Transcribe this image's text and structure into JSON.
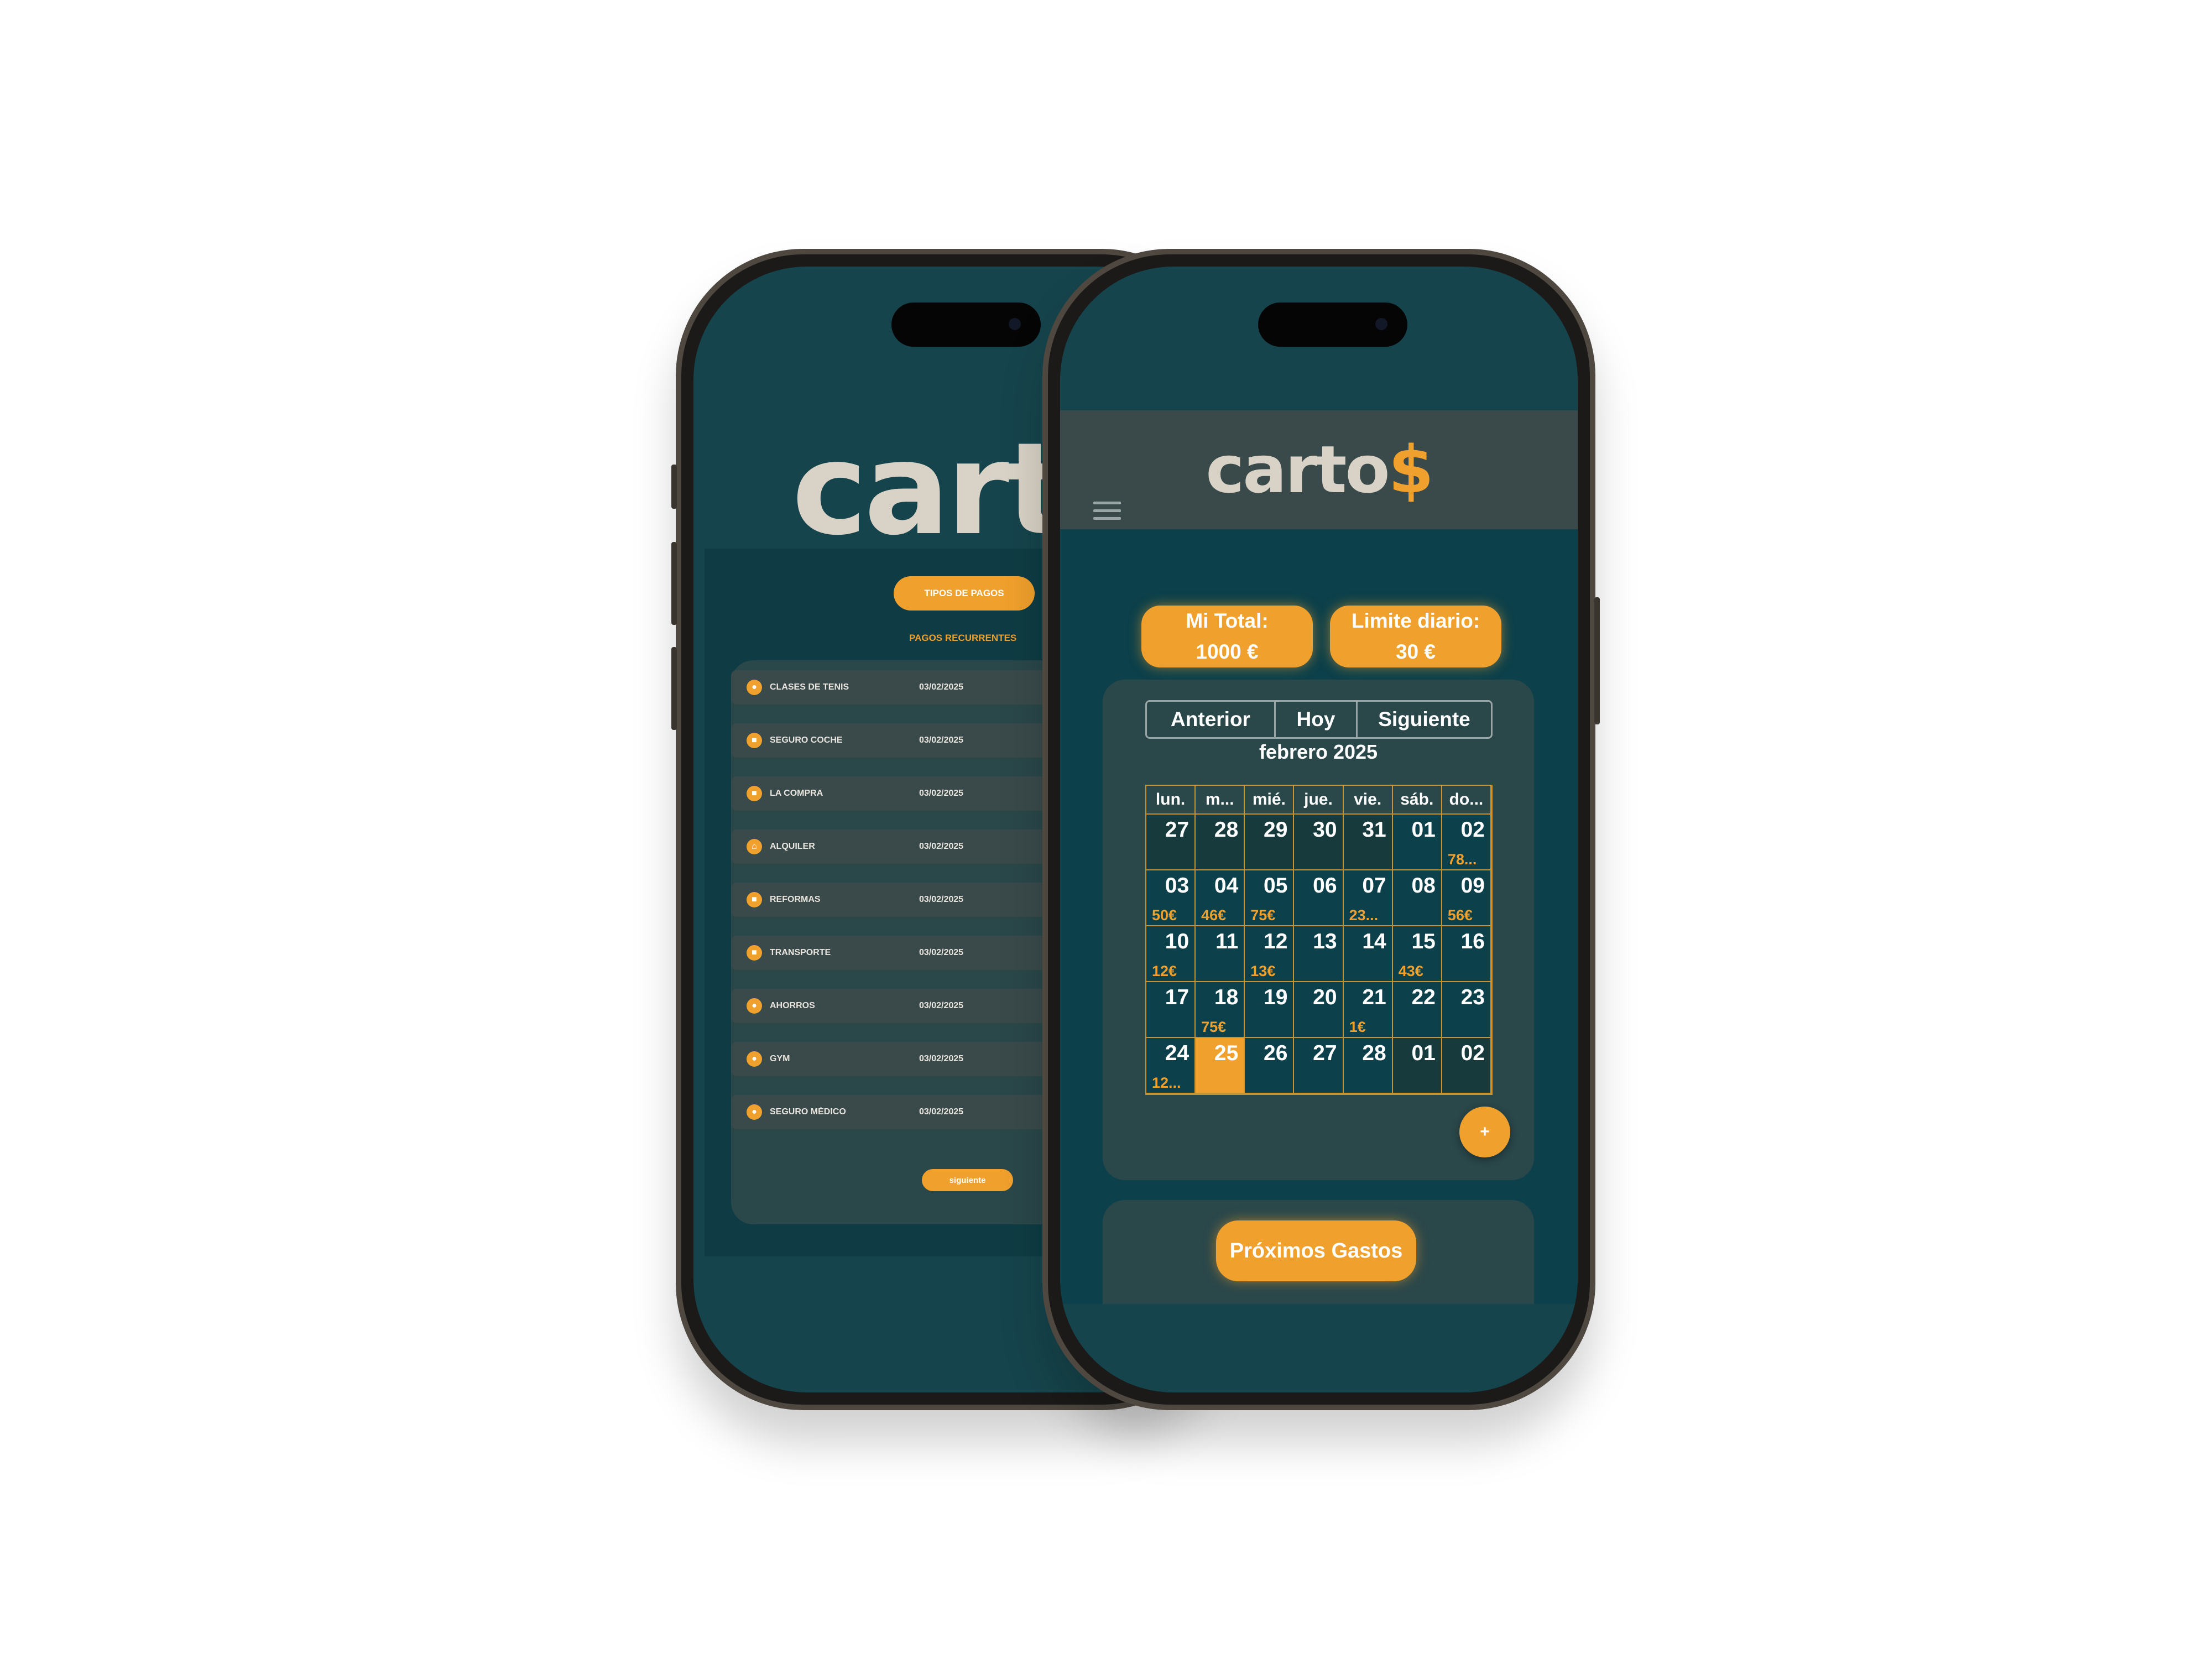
{
  "back_screen": {
    "logo_text": "carto",
    "types_button": "TIPOS DE PAGOS",
    "recurring_title": "PAGOS RECURRENTES",
    "items": [
      {
        "icon": "tennis-ball-icon",
        "glyph": "●",
        "name": "CLASES DE TENIS",
        "date": "03/02/2025"
      },
      {
        "icon": "car-icon",
        "glyph": "■",
        "name": "SEGURO COCHE",
        "date": "03/02/2025"
      },
      {
        "icon": "cart-icon",
        "glyph": "■",
        "name": "LA COMPRA",
        "date": "03/02/2025"
      },
      {
        "icon": "home-icon",
        "glyph": "⌂",
        "name": "ALQUILER",
        "date": "03/02/2025"
      },
      {
        "icon": "toolbox-icon",
        "glyph": "■",
        "name": "REFORMAS",
        "date": "03/02/2025"
      },
      {
        "icon": "bus-icon",
        "glyph": "■",
        "name": "TRANSPORTE",
        "date": "03/02/2025"
      },
      {
        "icon": "piggy-bank-icon",
        "glyph": "●",
        "name": "AHORROS",
        "date": "03/02/2025"
      },
      {
        "icon": "dumbbell-icon",
        "glyph": "●",
        "name": "GYM",
        "date": "03/02/2025"
      },
      {
        "icon": "medical-icon",
        "glyph": "●",
        "name": "SEGURO MÉDICO",
        "date": "03/02/2025"
      }
    ],
    "next_button": "siguiente"
  },
  "front_screen": {
    "logo_main": "carto",
    "logo_accent": "$",
    "total_label": "Mi Total:",
    "total_value": "1000 €",
    "limit_label": "Limite diario:",
    "limit_value": "30 €",
    "calendar": {
      "prev": "Anterior",
      "today": "Hoy",
      "next": "Siguiente",
      "month": "febrero 2025",
      "weekdays": [
        "lun.",
        "m...",
        "mié.",
        "jue.",
        "vie.",
        "sáb.",
        "do..."
      ],
      "days": [
        {
          "n": "27",
          "other": true
        },
        {
          "n": "28",
          "other": true
        },
        {
          "n": "29",
          "other": true
        },
        {
          "n": "30",
          "other": true
        },
        {
          "n": "31",
          "other": true
        },
        {
          "n": "01"
        },
        {
          "n": "02",
          "amt": "78..."
        },
        {
          "n": "03",
          "amt": "50€"
        },
        {
          "n": "04",
          "amt": "46€"
        },
        {
          "n": "05",
          "amt": "75€"
        },
        {
          "n": "06"
        },
        {
          "n": "07",
          "amt": "23..."
        },
        {
          "n": "08"
        },
        {
          "n": "09",
          "amt": "56€"
        },
        {
          "n": "10",
          "amt": "12€"
        },
        {
          "n": "11"
        },
        {
          "n": "12",
          "amt": "13€"
        },
        {
          "n": "13"
        },
        {
          "n": "14"
        },
        {
          "n": "15",
          "amt": "43€"
        },
        {
          "n": "16"
        },
        {
          "n": "17"
        },
        {
          "n": "18",
          "amt": "75€"
        },
        {
          "n": "19"
        },
        {
          "n": "20"
        },
        {
          "n": "21",
          "amt": "1€"
        },
        {
          "n": "22"
        },
        {
          "n": "23"
        },
        {
          "n": "24",
          "amt": "12..."
        },
        {
          "n": "25",
          "today": true
        },
        {
          "n": "26"
        },
        {
          "n": "27"
        },
        {
          "n": "28"
        },
        {
          "n": "01",
          "other": true
        },
        {
          "n": "02",
          "other": true
        }
      ]
    },
    "fab": "+",
    "upcoming_button": "Próximos Gastos"
  },
  "colors": {
    "accent": "#f0a02c",
    "background": "#0c404a",
    "card": "#2a474a"
  }
}
